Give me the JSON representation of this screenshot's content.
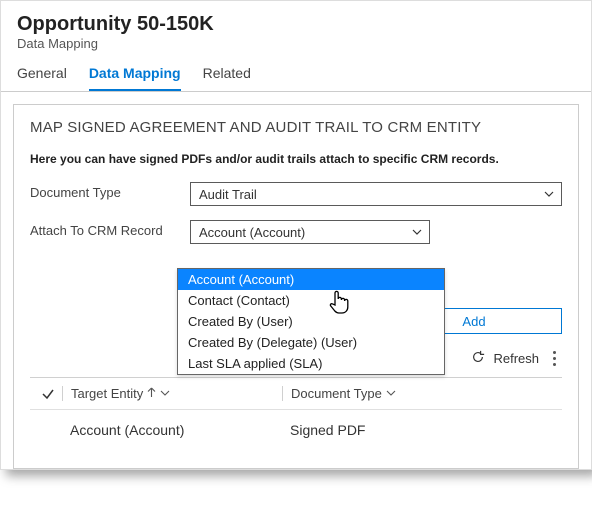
{
  "header": {
    "title": "Opportunity 50-150K",
    "subtitle": "Data Mapping"
  },
  "tabs": {
    "general": "General",
    "dataMapping": "Data Mapping",
    "related": "Related"
  },
  "section": {
    "title": "MAP SIGNED AGREEMENT AND AUDIT TRAIL TO CRM ENTITY",
    "desc": "Here you can have signed PDFs and/or audit trails attach to specific CRM records."
  },
  "fields": {
    "documentType": {
      "label": "Document Type",
      "value": "Audit Trail"
    },
    "attachTo": {
      "label": "Attach To CRM Record",
      "value": "Account (Account)"
    }
  },
  "attachOptions": [
    "Account (Account)",
    "Contact (Contact)",
    "Created By (User)",
    "Created By (Delegate) (User)",
    "Last SLA applied (SLA)"
  ],
  "buttons": {
    "add": "Add",
    "refresh": "Refresh"
  },
  "grid": {
    "columns": {
      "targetEntity": "Target Entity",
      "documentType": "Document Type"
    },
    "rows": [
      {
        "targetEntity": "Account (Account)",
        "documentType": "Signed PDF"
      }
    ]
  }
}
